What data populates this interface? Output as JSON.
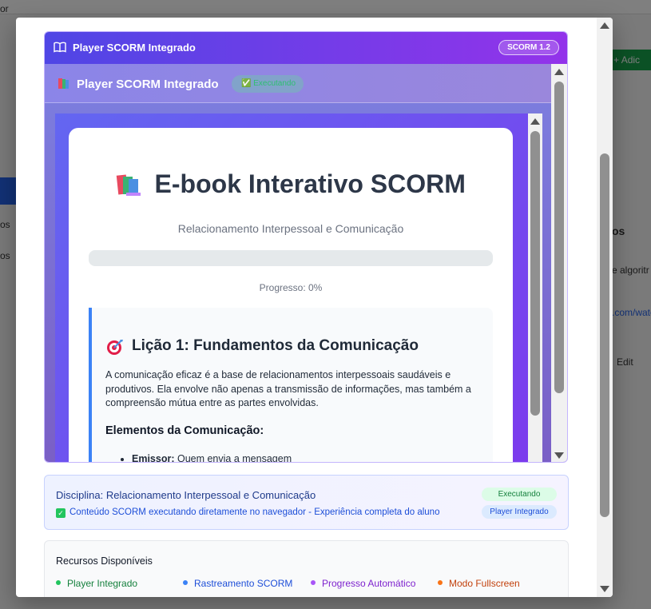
{
  "background": {
    "fragments": [
      "or",
      "os",
      "os",
      "os",
      "e algoritr",
      ".com/watc",
      "Edit"
    ],
    "add_button_label": "Adic"
  },
  "player": {
    "header_title": "Player SCORM Integrado",
    "version_badge": "SCORM 1.2",
    "inner_title": "Player SCORM Integrado",
    "inner_status": "Executando"
  },
  "ebook": {
    "title": "E-book Interativo SCORM",
    "subtitle": "Relacionamento Interpessoal e Comunicação",
    "progress_value": 0,
    "progress_label": "Progresso: 0%",
    "lesson": {
      "title": "Lição 1: Fundamentos da Comunicação",
      "body": "A comunicação eficaz é a base de relacionamentos interpessoais saudáveis e produtivos. Ela envolve não apenas a transmissão de informações, mas também a compreensão mútua entre as partes envolvidas.",
      "section_heading": "Elementos da Comunicação:",
      "items": [
        {
          "term": "Emissor:",
          "text": " Quem envia a mensagem"
        }
      ]
    }
  },
  "discipline": {
    "name": "Disciplina: Relacionamento Interpessoal e Comunicação",
    "description": "Conteúdo SCORM executando diretamente no navegador - Experiência completa do aluno",
    "badge_status": "Executando",
    "badge_player": "Player Integrado"
  },
  "resources": {
    "heading": "Recursos Disponíveis",
    "items": [
      {
        "label": "Player Integrado",
        "color": "#22c55e",
        "text_color": "#15803d"
      },
      {
        "label": "Rastreamento SCORM",
        "color": "#3b82f6",
        "text_color": "#1d4ed8"
      },
      {
        "label": "Progresso Automático",
        "color": "#a855f7",
        "text_color": "#7e22ce"
      },
      {
        "label": "Modo Fullscreen",
        "color": "#f97316",
        "text_color": "#c2410c"
      }
    ]
  },
  "colors": {
    "header_gradient_start": "#4f46e5",
    "header_gradient_end": "#9333ea",
    "accent_blue": "#3b82f6"
  }
}
